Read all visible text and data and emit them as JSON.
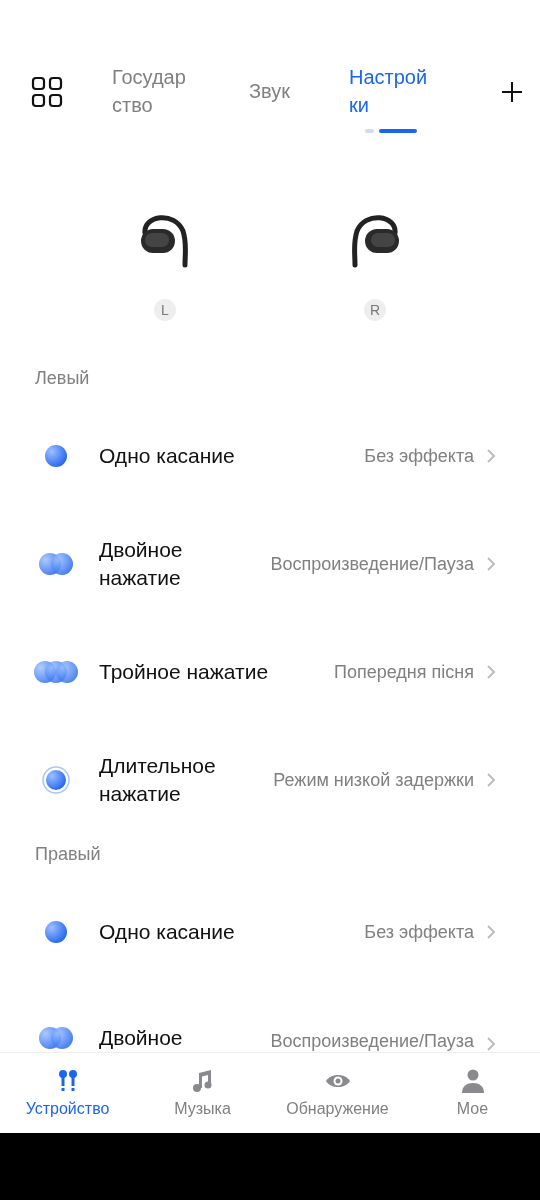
{
  "tabs": [
    {
      "label": "Государ ство",
      "selected": false
    },
    {
      "label": "Звук",
      "selected": false
    },
    {
      "label": "Настрой ки",
      "selected": true
    }
  ],
  "earbuds": [
    {
      "kind": "left",
      "badge": "L"
    },
    {
      "kind": "right",
      "badge": "R"
    }
  ],
  "sections": [
    {
      "title": "Левый",
      "rows": [
        {
          "kind": "single",
          "label": "Одно касание",
          "value": "Без эффекта"
        },
        {
          "kind": "double",
          "label": "Двойное нажатие",
          "value": "Воспроизведение/Пауза"
        },
        {
          "kind": "triple",
          "label": "Тройное нажатие",
          "value": "Попередня пісня"
        },
        {
          "kind": "long",
          "label": "Длительное нажатие",
          "value": "Режим низкой задержки"
        }
      ]
    },
    {
      "title": "Правый",
      "rows": [
        {
          "kind": "single",
          "label": "Одно касание",
          "value": "Без эффекта"
        },
        {
          "kind": "double",
          "label": "Двойное",
          "value": "Воспроизведение/Пауза"
        }
      ]
    }
  ],
  "nav": [
    {
      "kind": "earbuds",
      "label": "Устройство",
      "selected": true
    },
    {
      "kind": "music",
      "label": "Музыка",
      "selected": false
    },
    {
      "kind": "eye",
      "label": "Обнаружение",
      "selected": false
    },
    {
      "kind": "person",
      "label": "Мое",
      "selected": false
    }
  ]
}
